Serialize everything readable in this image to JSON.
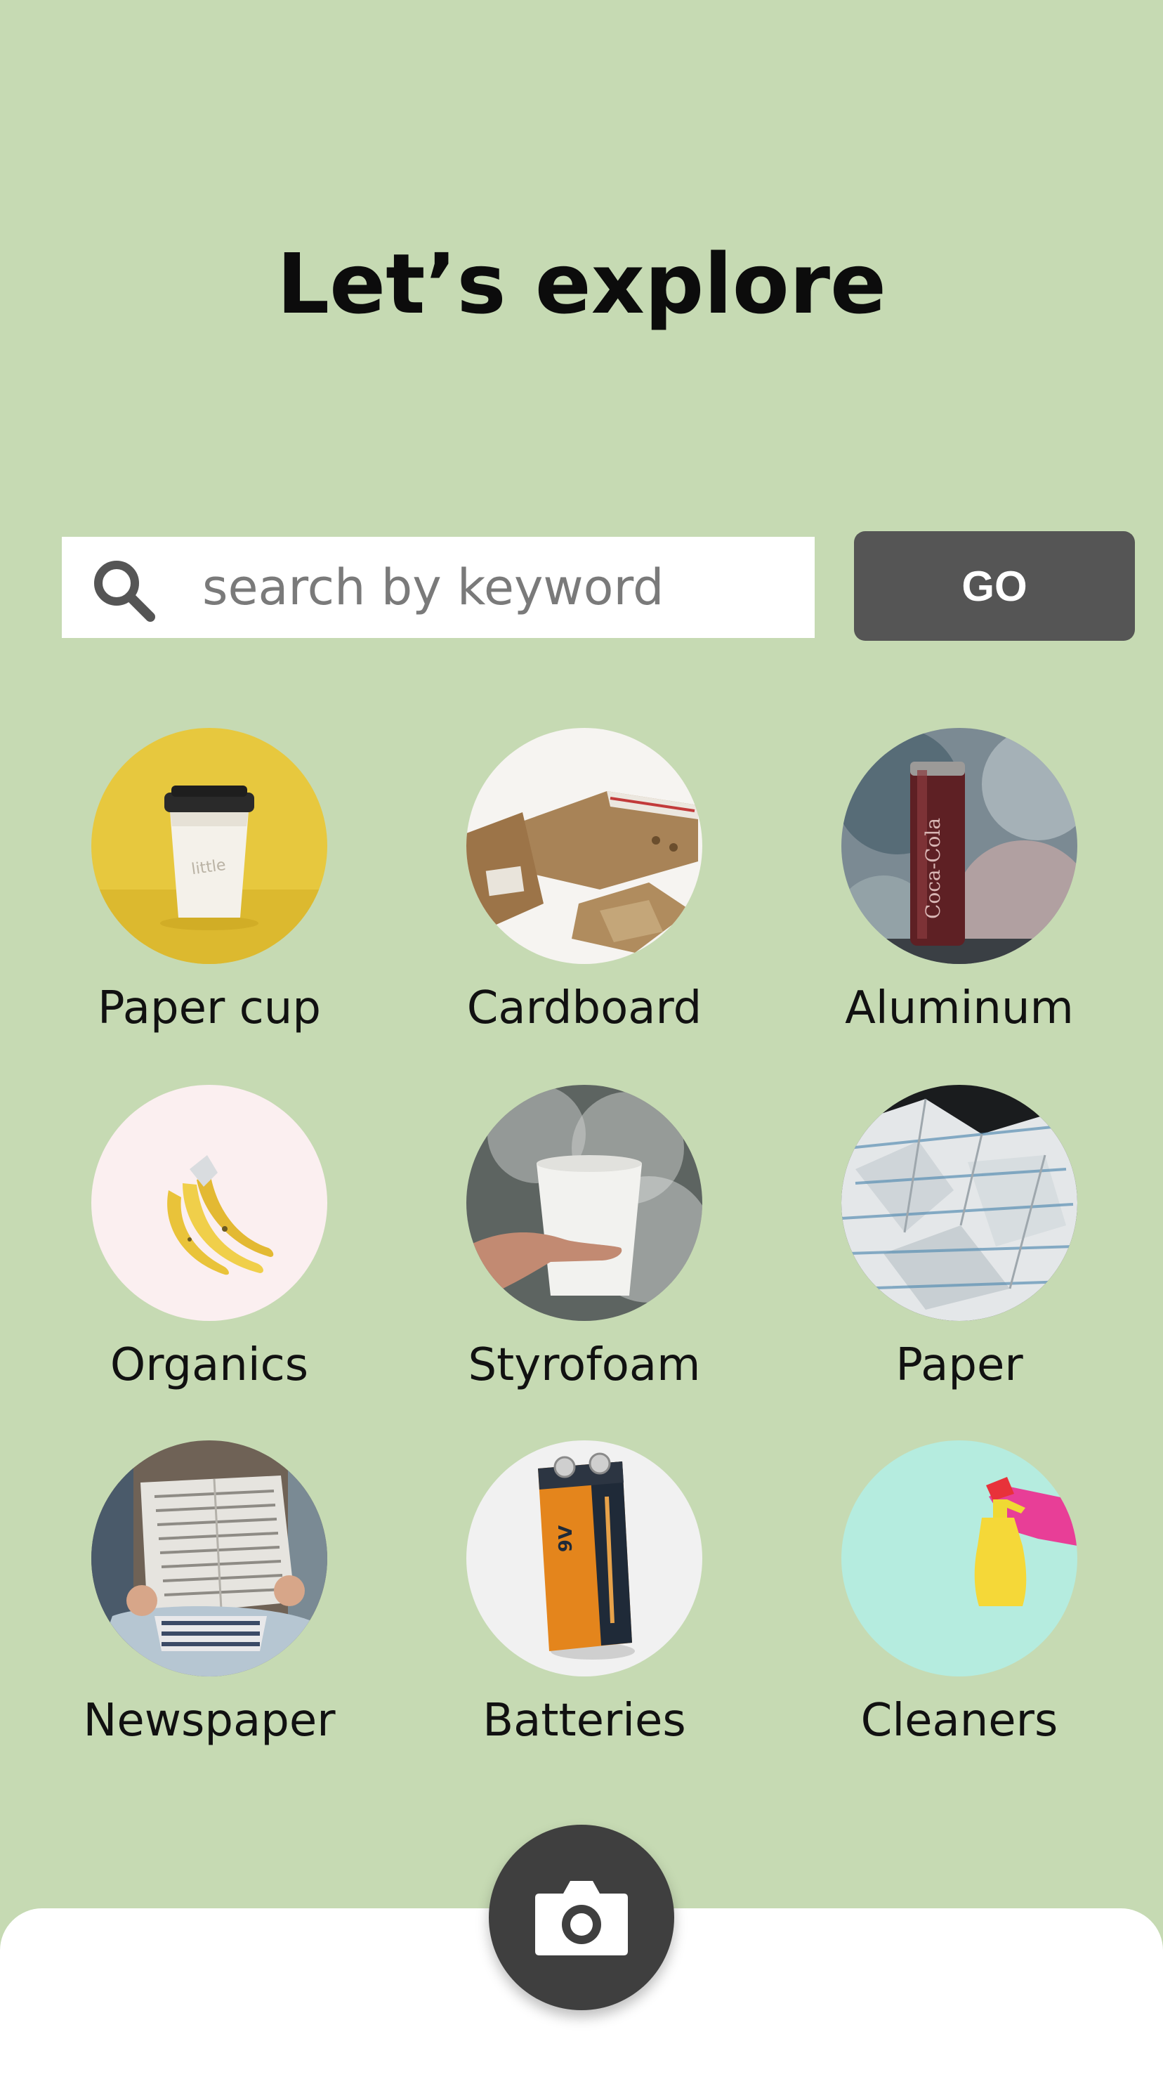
{
  "header": {
    "title": "Let’s explore"
  },
  "search": {
    "placeholder": "search by keyword",
    "value": "",
    "go_label": "GO"
  },
  "categories": [
    {
      "label": "Paper cup",
      "icon": "paper-cup-image"
    },
    {
      "label": "Cardboard",
      "icon": "cardboard-image"
    },
    {
      "label": "Aluminum",
      "icon": "aluminum-can-image"
    },
    {
      "label": "Organics",
      "icon": "bananas-image"
    },
    {
      "label": "Styrofoam",
      "icon": "styrofoam-cup-image"
    },
    {
      "label": "Paper",
      "icon": "crumpled-paper-image"
    },
    {
      "label": "Newspaper",
      "icon": "newspaper-image"
    },
    {
      "label": "Batteries",
      "icon": "battery-image"
    },
    {
      "label": "Cleaners",
      "icon": "spray-bottle-image"
    }
  ],
  "bottom_nav": {
    "camera_icon": "camera-icon"
  },
  "colors": {
    "background": "#c6dab3",
    "go_button": "#555555",
    "camera_button": "#3f3f3f",
    "bottom_bar": "#ffffff"
  }
}
